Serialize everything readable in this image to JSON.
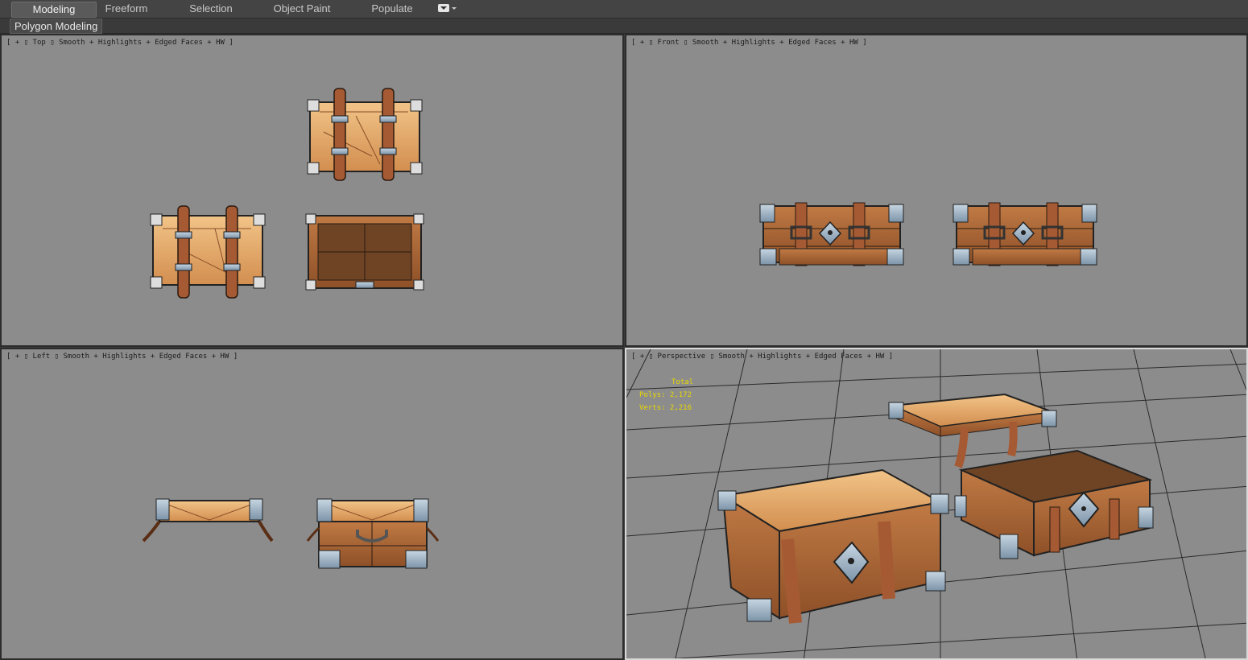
{
  "ribbon": {
    "tabs": [
      {
        "label": "Modeling",
        "active": true
      },
      {
        "label": "Freeform",
        "active": false
      },
      {
        "label": "Selection",
        "active": false
      },
      {
        "label": "Object Paint",
        "active": false
      },
      {
        "label": "Populate",
        "active": false
      }
    ],
    "dropdown_icon": "dropdown-toggle-icon"
  },
  "subbar": {
    "panel_label": "Polygon Modeling"
  },
  "viewports": {
    "top": {
      "view": "Top",
      "shading": "Smooth + Highlights + Edged Faces + HW"
    },
    "front": {
      "view": "Front",
      "shading": "Smooth + Highlights + Edged Faces + HW"
    },
    "left": {
      "view": "Left",
      "shading": "Smooth + Highlights + Edged Faces + HW"
    },
    "perspective": {
      "view": "Perspective",
      "shading": "Smooth + Highlights + Edged Faces + HW"
    }
  },
  "bracket_open": "[",
  "bracket_close": "]",
  "plus": "+",
  "sep": "▯",
  "stats": {
    "total_label": "Total",
    "polys": "Polys: 2,172",
    "verts": "Verts: 2,216"
  },
  "colors": {
    "viewport_bg": "#8c8c8c",
    "wood": "#e3a463",
    "wood_dark": "#a9663a",
    "strap": "#a65a33",
    "metal": "#8ea7bd",
    "stats_text": "#e8d800"
  }
}
